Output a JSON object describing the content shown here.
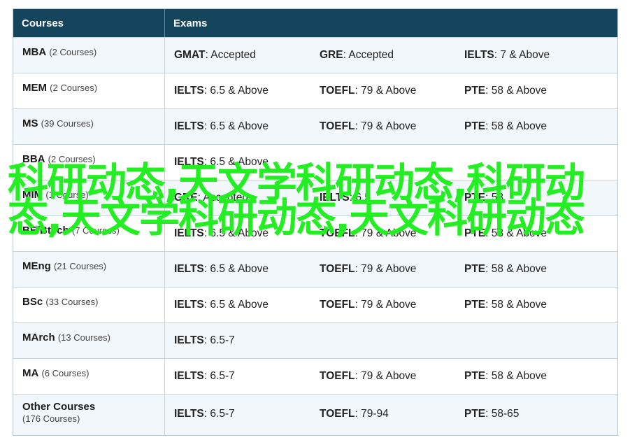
{
  "header": {
    "courses": "Courses",
    "exams": "Exams"
  },
  "rows": [
    {
      "name": "MBA",
      "count": "(2 Courses)",
      "exams": [
        {
          "name": "GMAT",
          "req": ": Accepted"
        },
        {
          "name": "GRE",
          "req": ": Accepted"
        },
        {
          "name": "IELTS",
          "req": ": 7 & Above"
        }
      ]
    },
    {
      "name": "MEM",
      "count": "(2 Courses)",
      "exams": [
        {
          "name": "IELTS",
          "req": ": 6.5 & Above"
        },
        {
          "name": "TOEFL",
          "req": ": 79 & Above"
        },
        {
          "name": "PTE",
          "req": ": 58 & Above"
        }
      ]
    },
    {
      "name": "MS",
      "count": "(39 Courses)",
      "exams": [
        {
          "name": "IELTS",
          "req": ": 6.5 & Above"
        },
        {
          "name": "TOEFL",
          "req": ": 79 & Above"
        },
        {
          "name": "PTE",
          "req": ": 58 & Above"
        }
      ]
    },
    {
      "name": "BBA",
      "count": "(2 Courses)",
      "exams": [
        {
          "name": "IELTS",
          "req": ": 6.5 & Above"
        },
        {
          "name": "",
          "req": ""
        },
        {
          "name": "",
          "req": ""
        }
      ]
    },
    {
      "name": "MIM",
      "count": "(1 Course)",
      "exams": [
        {
          "name": "GRE",
          "req": ": Accepted"
        },
        {
          "name": "IELTS",
          "req": ": 6.5"
        },
        {
          "name": "PTE",
          "req": ": 58"
        }
      ]
    },
    {
      "name": "BE/Btech",
      "count": "(7 Courses)",
      "exams": [
        {
          "name": "IELTS",
          "req": ": 6.5 & Above"
        },
        {
          "name": "TOEFL",
          "req": ": 79 & Above"
        },
        {
          "name": "PTE",
          "req": ": 58 & Above"
        }
      ]
    },
    {
      "name": "MEng",
      "count": "(21 Courses)",
      "exams": [
        {
          "name": "IELTS",
          "req": ": 6.5 & Above"
        },
        {
          "name": "TOEFL",
          "req": ": 79 & Above"
        },
        {
          "name": "PTE",
          "req": ": 58 & Above"
        }
      ]
    },
    {
      "name": "BSc",
      "count": "(33 Courses)",
      "exams": [
        {
          "name": "IELTS",
          "req": ": 6.5 & Above"
        },
        {
          "name": "TOEFL",
          "req": ": 79 & Above"
        },
        {
          "name": "PTE",
          "req": ": 58 & Above"
        }
      ]
    },
    {
      "name": "MArch",
      "count": "(13 Courses)",
      "exams": [
        {
          "name": "IELTS",
          "req": ": 6.5-7"
        },
        {
          "name": "",
          "req": ""
        },
        {
          "name": "",
          "req": ""
        }
      ]
    },
    {
      "name": "MA",
      "count": "(6 Courses)",
      "exams": [
        {
          "name": "IELTS",
          "req": ": 6.5-7"
        },
        {
          "name": "TOEFL",
          "req": ": 79 & Above"
        },
        {
          "name": "PTE",
          "req": ": 58 & Above"
        }
      ]
    },
    {
      "name": "Other Courses",
      "count": "(176 Courses)",
      "exams": [
        {
          "name": "IELTS",
          "req": ": 6.5-7"
        },
        {
          "name": "TOEFL",
          "req": ": 79-94"
        },
        {
          "name": "PTE",
          "req": ": 58-65"
        }
      ]
    }
  ],
  "watermark": "科研动态,天文学科研动态,科研动态,天文学科研动态,天文科研动态",
  "colors": {
    "header_bg": "#15445d",
    "watermark": "#22ee22"
  }
}
